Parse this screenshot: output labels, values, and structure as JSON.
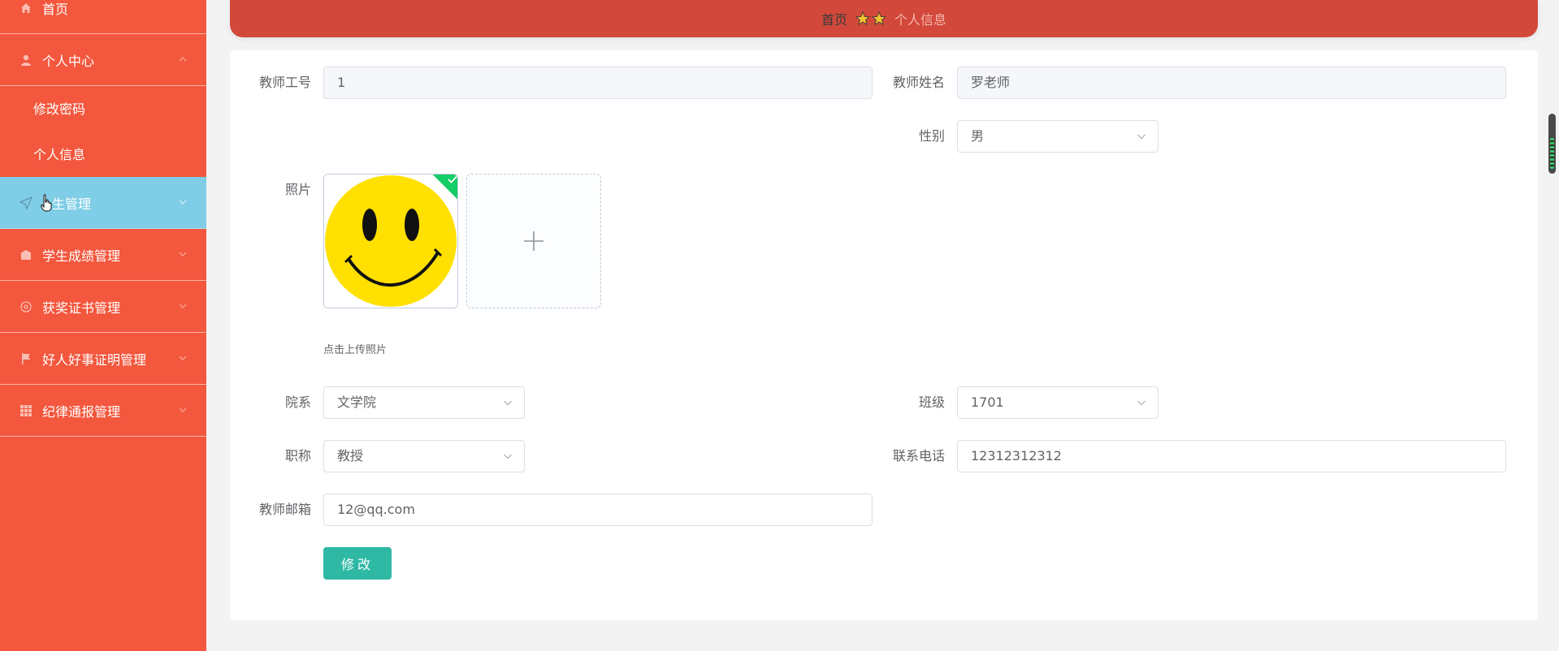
{
  "sidebar": {
    "items": [
      {
        "label": "首页",
        "icon": "home-icon"
      },
      {
        "label": "个人中心",
        "icon": "user-icon",
        "children": [
          "修改密码",
          "个人信息"
        ]
      },
      {
        "label": "学生管理",
        "icon": "navigation-icon",
        "active": true
      },
      {
        "label": "学生成绩管理",
        "icon": "bank-icon"
      },
      {
        "label": "获奖证书管理",
        "icon": "target-icon"
      },
      {
        "label": "好人好事证明管理",
        "icon": "flag-icon"
      },
      {
        "label": "纪律通报管理",
        "icon": "grid-icon"
      }
    ],
    "visible_active_label": "生管理"
  },
  "breadcrumb": {
    "home": "首页",
    "current": "个人信息"
  },
  "form": {
    "teacher_id": {
      "label": "教师工号",
      "value": "1"
    },
    "teacher_name": {
      "label": "教师姓名",
      "value": "罗老师"
    },
    "gender": {
      "label": "性别",
      "value": "男"
    },
    "photo": {
      "label": "照片",
      "hint": "点击上传照片"
    },
    "department": {
      "label": "院系",
      "value": "文学院"
    },
    "class": {
      "label": "班级",
      "value": "1701"
    },
    "title": {
      "label": "职称",
      "value": "教授"
    },
    "phone": {
      "label": "联系电话",
      "value": "12312312312"
    },
    "email": {
      "label": "教师邮箱",
      "value": "12@qq.com"
    },
    "submit_label": "修改"
  },
  "colors": {
    "sidebar_bg": "#f3573d",
    "active_item_bg": "#7fcde6",
    "topbar_bg": "#d2483a",
    "submit_bg": "#2fb9a5",
    "success_corner": "#13ce66"
  }
}
